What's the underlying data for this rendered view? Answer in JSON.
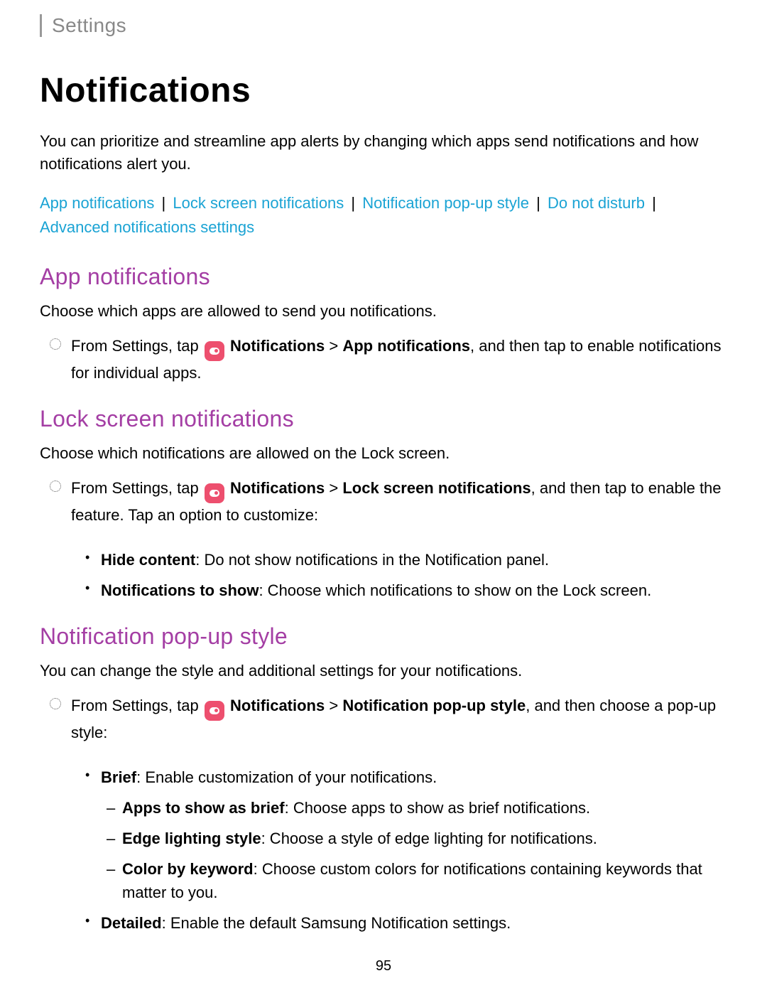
{
  "breadcrumb": "Settings",
  "title": "Notifications",
  "intro": "You can prioritize and streamline app alerts by changing which apps send notifications and how notifications alert you.",
  "links": {
    "l1": "App notifications",
    "l2": "Lock screen notifications",
    "l3": "Notification pop-up style",
    "l4": "Do not disturb",
    "l5": "Advanced notifications settings"
  },
  "s1": {
    "heading": "App notifications",
    "body": "Choose which apps are allowed to send you notifications.",
    "step_pre": "From Settings, tap",
    "step_b1": "Notifications",
    "step_gt": ">",
    "step_b2": "App notifications",
    "step_post": ", and then tap to enable notifications for individual apps."
  },
  "s2": {
    "heading": "Lock screen notifications",
    "body": "Choose which notifications are allowed on the Lock screen.",
    "step_pre": "From Settings, tap",
    "step_b1": "Notifications",
    "step_gt": ">",
    "step_b2": "Lock screen notifications",
    "step_post": ", and then tap to enable the feature. Tap an option to customize:",
    "b1_label": "Hide content",
    "b1_text": ": Do not show notifications in the Notification panel.",
    "b2_label": "Notifications to show",
    "b2_text": ": Choose which notifications to show on the Lock screen."
  },
  "s3": {
    "heading": "Notification pop-up style",
    "body": "You can change the style and additional settings for your notifications.",
    "step_pre": "From Settings, tap",
    "step_b1": "Notifications",
    "step_gt": ">",
    "step_b2": "Notification pop-up style",
    "step_post": ", and then choose a pop-up style:",
    "b1_label": "Brief",
    "b1_text": ": Enable customization of your notifications.",
    "d1_label": "Apps to show as brief",
    "d1_text": ": Choose apps to show as brief notifications.",
    "d2_label": "Edge lighting style",
    "d2_text": ": Choose a style of edge lighting for notifications.",
    "d3_label": "Color by keyword",
    "d3_text": ": Choose custom colors for notifications containing keywords that matter to you.",
    "b2_label": "Detailed",
    "b2_text": ": Enable the default Samsung Notification settings."
  },
  "page_number": "95"
}
